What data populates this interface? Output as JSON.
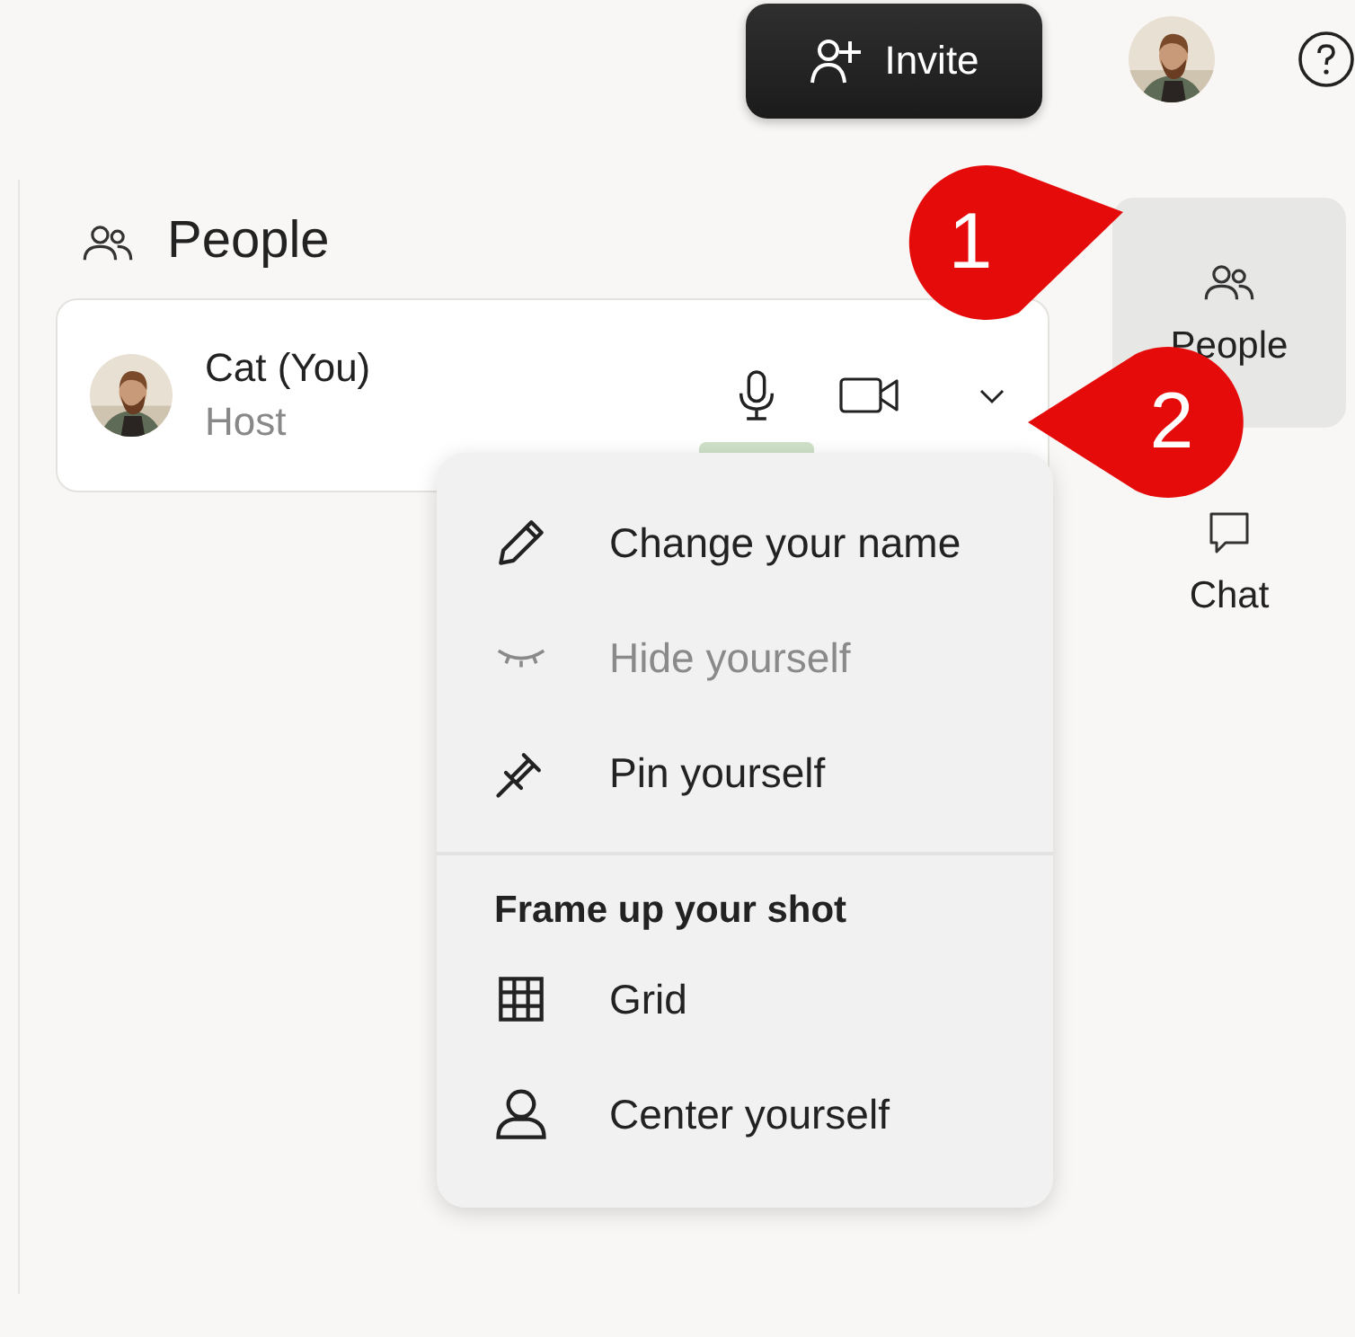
{
  "topbar": {
    "invite_button": "Invite"
  },
  "panel": {
    "title": "People"
  },
  "participant": {
    "name": "Cat (You)",
    "role": "Host",
    "speaking": true
  },
  "menu": {
    "items": [
      {
        "kind": "action",
        "label": "Change your name",
        "disabled": false
      },
      {
        "kind": "action",
        "label": "Hide yourself",
        "disabled": true
      },
      {
        "kind": "action",
        "label": "Pin yourself",
        "disabled": false
      },
      {
        "kind": "divider"
      },
      {
        "kind": "heading",
        "label": "Frame up your shot"
      },
      {
        "kind": "action",
        "label": "Grid",
        "disabled": false
      },
      {
        "kind": "action",
        "label": "Center yourself",
        "disabled": false
      }
    ]
  },
  "rail": [
    {
      "label": "People",
      "selected": true
    },
    {
      "label": "Chat",
      "selected": false
    }
  ],
  "annotations": [
    {
      "label": "1"
    },
    {
      "label": "2"
    }
  ]
}
